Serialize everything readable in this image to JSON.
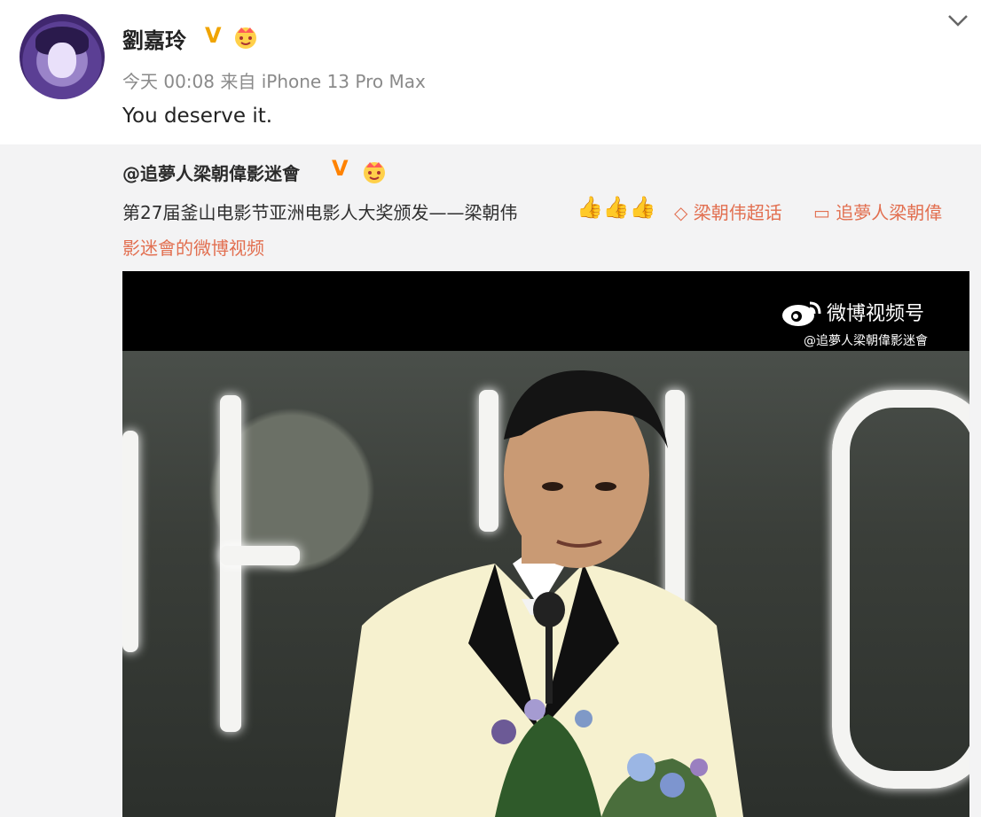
{
  "post": {
    "author": "劉嘉玲",
    "time": "今天 00:08",
    "source": "来自 iPhone 13 Pro Max",
    "text": "You deserve it."
  },
  "repost": {
    "author": "@追夢人梁朝偉影迷會",
    "text_main": "第27届釜山电影节亚洲电影人大奖颁发——梁朝伟",
    "thumbs": "👍👍👍",
    "tag_supertopic": "梁朝伟超话",
    "tag_video_prefix": "追夢人梁朝偉",
    "tag_video_suffix": "影迷會的微博视频"
  },
  "video": {
    "watermark_title": "微博视频号",
    "watermark_sub": "@追夢人梁朝偉影迷會"
  },
  "icons": {
    "verified": "verified-badge-icon",
    "crown": "crown-emoji-icon",
    "chevron": "chevron-down-icon",
    "weibo": "weibo-logo-icon"
  },
  "colors": {
    "link": "#e26f50",
    "verified_gold": "#f0a400",
    "repost_bg": "#f3f3f4"
  }
}
